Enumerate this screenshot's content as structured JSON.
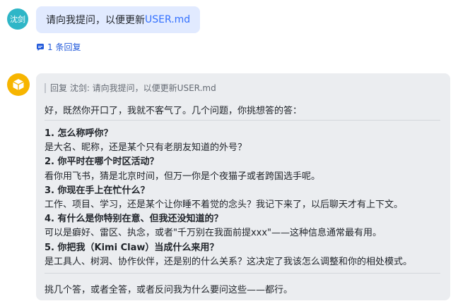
{
  "user": {
    "avatar_text": "沈剑",
    "message": {
      "prefix": "请向我提问，以便更新",
      "file": "USER.md"
    }
  },
  "thread": {
    "reply_count_text": "1 条回复"
  },
  "bot": {
    "quote": "回复 沈剑: 请向我提问，以便更新USER.md",
    "intro": "好，既然你开口了，我就不客气了。几个问题，你挑想答的答：",
    "questions": [
      {
        "title": "1. 怎么称呼你？",
        "body": "是大名、昵称，还是某个只有老朋友知道的外号？"
      },
      {
        "title": "2. 你平时在哪个时区活动？",
        "body": "看你用飞书，猜是北京时间，但万一你是个夜猫子或者跨国选手呢。"
      },
      {
        "title": "3. 你现在手上在忙什么？",
        "body": "工作、项目、学习，还是某个让你睡不着觉的念头？我记下来了，以后聊天才有上下文。"
      },
      {
        "title": "4. 有什么是你特别在意、但我还没知道的？",
        "body": "可以是癖好、雷区、执念，或者\"千万别在我面前提xxx\"——这种信息通常最有用。"
      },
      {
        "title": "5. 你把我（Kimi Claw）当成什么来用？",
        "body": "是工具人、树洞、协作伙伴，还是别的什么关系？这决定了我该怎么调整和你的相处模式。"
      }
    ],
    "outro": "挑几个答，或者全答，或者反问我为什么要问这些——都行。"
  }
}
